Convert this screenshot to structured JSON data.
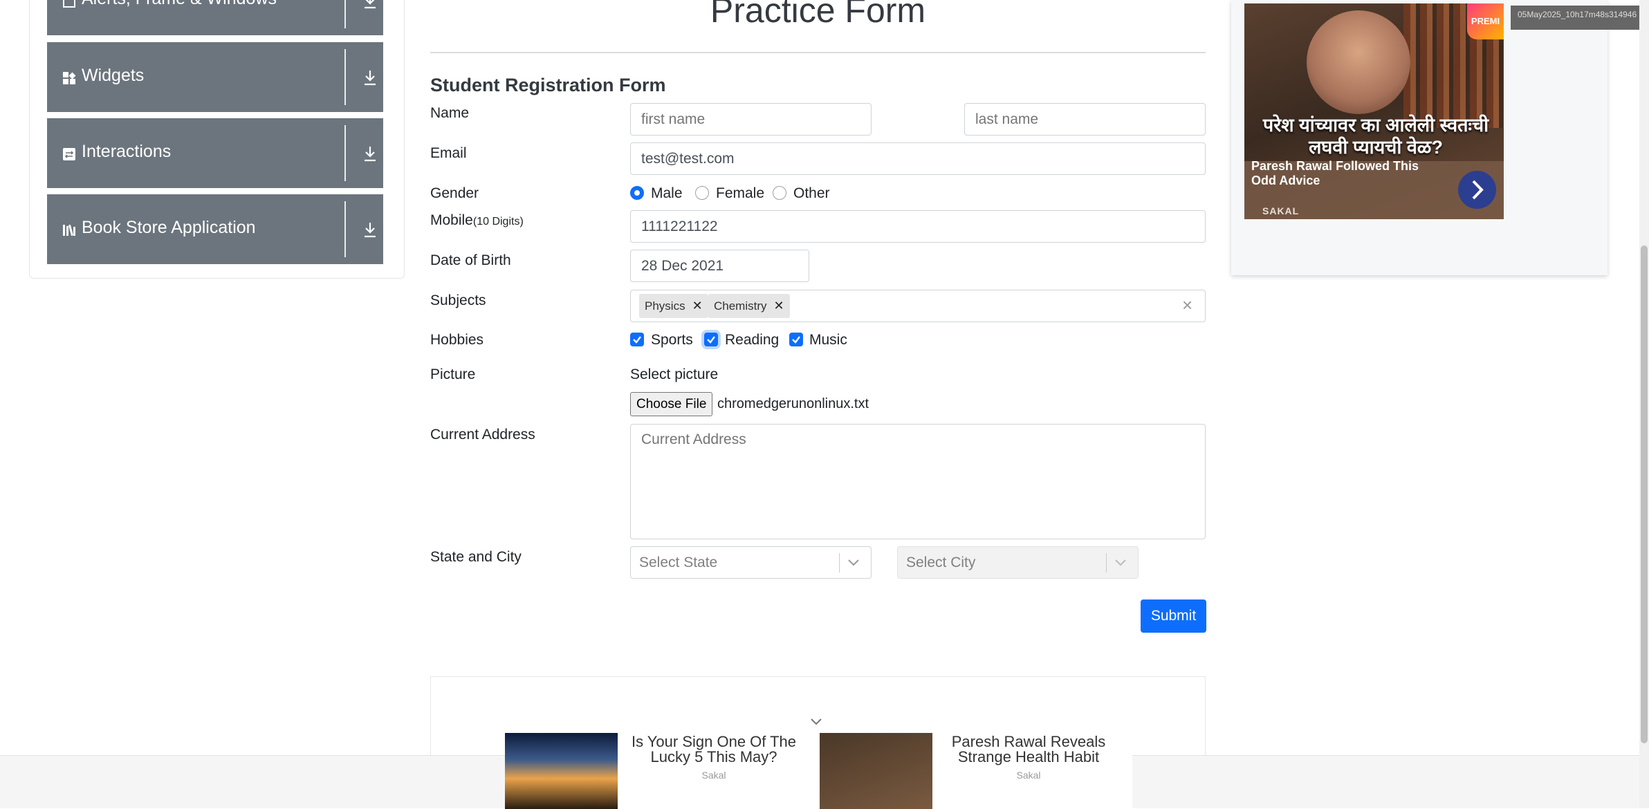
{
  "sidebar": {
    "groups": [
      {
        "label": "Alerts, Frame & Windows",
        "icon": "window-icon"
      },
      {
        "label": "Widgets",
        "icon": "widgets-icon"
      },
      {
        "label": "Interactions",
        "icon": "interactions-icon"
      },
      {
        "label": "Book Store Application",
        "icon": "books-icon"
      }
    ]
  },
  "page": {
    "title": "Practice Form",
    "form_title": "Student Registration Form"
  },
  "form": {
    "name": {
      "label": "Name",
      "first_placeholder": "first name",
      "last_placeholder": "last name"
    },
    "email": {
      "label": "Email",
      "value": "test@test.com"
    },
    "gender": {
      "label": "Gender",
      "options": [
        "Male",
        "Female",
        "Other"
      ],
      "selected": "Male"
    },
    "mobile": {
      "label": "Mobile",
      "hint": "(10 Digits)",
      "value": "1111221122"
    },
    "dob": {
      "label": "Date of Birth",
      "value": "28 Dec 2021"
    },
    "subjects": {
      "label": "Subjects",
      "chips": [
        "Physics",
        "Chemistry"
      ]
    },
    "hobbies": {
      "label": "Hobbies",
      "options": [
        "Sports",
        "Reading",
        "Music"
      ],
      "checked": [
        "Sports",
        "Reading",
        "Music"
      ]
    },
    "picture": {
      "label": "Picture",
      "select_label": "Select picture",
      "button": "Choose File",
      "file_name": "chromedgerunonlinux.txt"
    },
    "address": {
      "label": "Current Address",
      "placeholder": "Current Address"
    },
    "state_city": {
      "label": "State and City",
      "state_placeholder": "Select State",
      "city_placeholder": "Select City"
    },
    "submit": "Submit"
  },
  "ad": {
    "headline": "परेश यांच्यावर का आलेली स्वतःची लघवी प्यायची वेळ?",
    "caption": "Paresh Rawal Followed This Odd Advice",
    "source": "SAKAL",
    "badge": "PREMI"
  },
  "stamp": "05May2025_10h17m48s314946",
  "recommendations": [
    {
      "title": "Is Your Sign One Of The Lucky 5 This May?",
      "source": "Sakal"
    },
    {
      "title": "Paresh Rawal Reveals Strange Health Habit",
      "source": "Sakal"
    }
  ],
  "colors": {
    "sidebar_group": "#6c757d",
    "primary": "#0d6efd"
  }
}
